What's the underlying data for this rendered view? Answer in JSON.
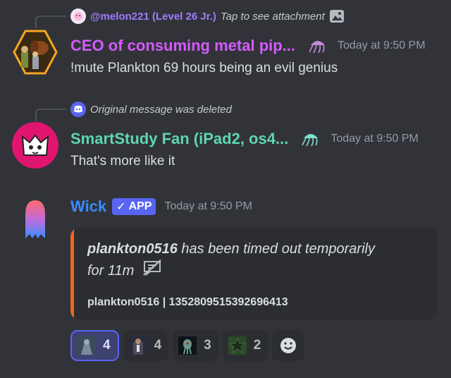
{
  "messages": [
    {
      "reply_name": "@melon221 (Level 26 Jr.)",
      "reply_text": "Tap to see attachment",
      "username": "CEO of consuming metal pip...",
      "username_color": "#d45bff",
      "timestamp": "Today at 9:50 PM",
      "content": "!mute Plankton 69 hours being an evil genius"
    },
    {
      "reply_text": "Original message was deleted",
      "username": "SmartStudy Fan (iPad2, os4...",
      "username_color": "#5fd6b0",
      "timestamp": "Today at 9:50 PM",
      "content": "That's more like it"
    },
    {
      "username": "Wick",
      "username_color": "#3b8cff",
      "badge": "APP",
      "timestamp": "Today at 9:50 PM",
      "embed": {
        "title_bold": "plankton0516",
        "title_rest": " has been timed out temporarily",
        "title_line2": "for 11m",
        "footer": "plankton0516 | 1352809515392696413",
        "accent": "#f26522"
      }
    }
  ],
  "reactions": [
    {
      "count": "4",
      "active": true
    },
    {
      "count": "4",
      "active": false
    },
    {
      "count": "3",
      "active": false
    },
    {
      "count": "2",
      "active": false
    }
  ]
}
